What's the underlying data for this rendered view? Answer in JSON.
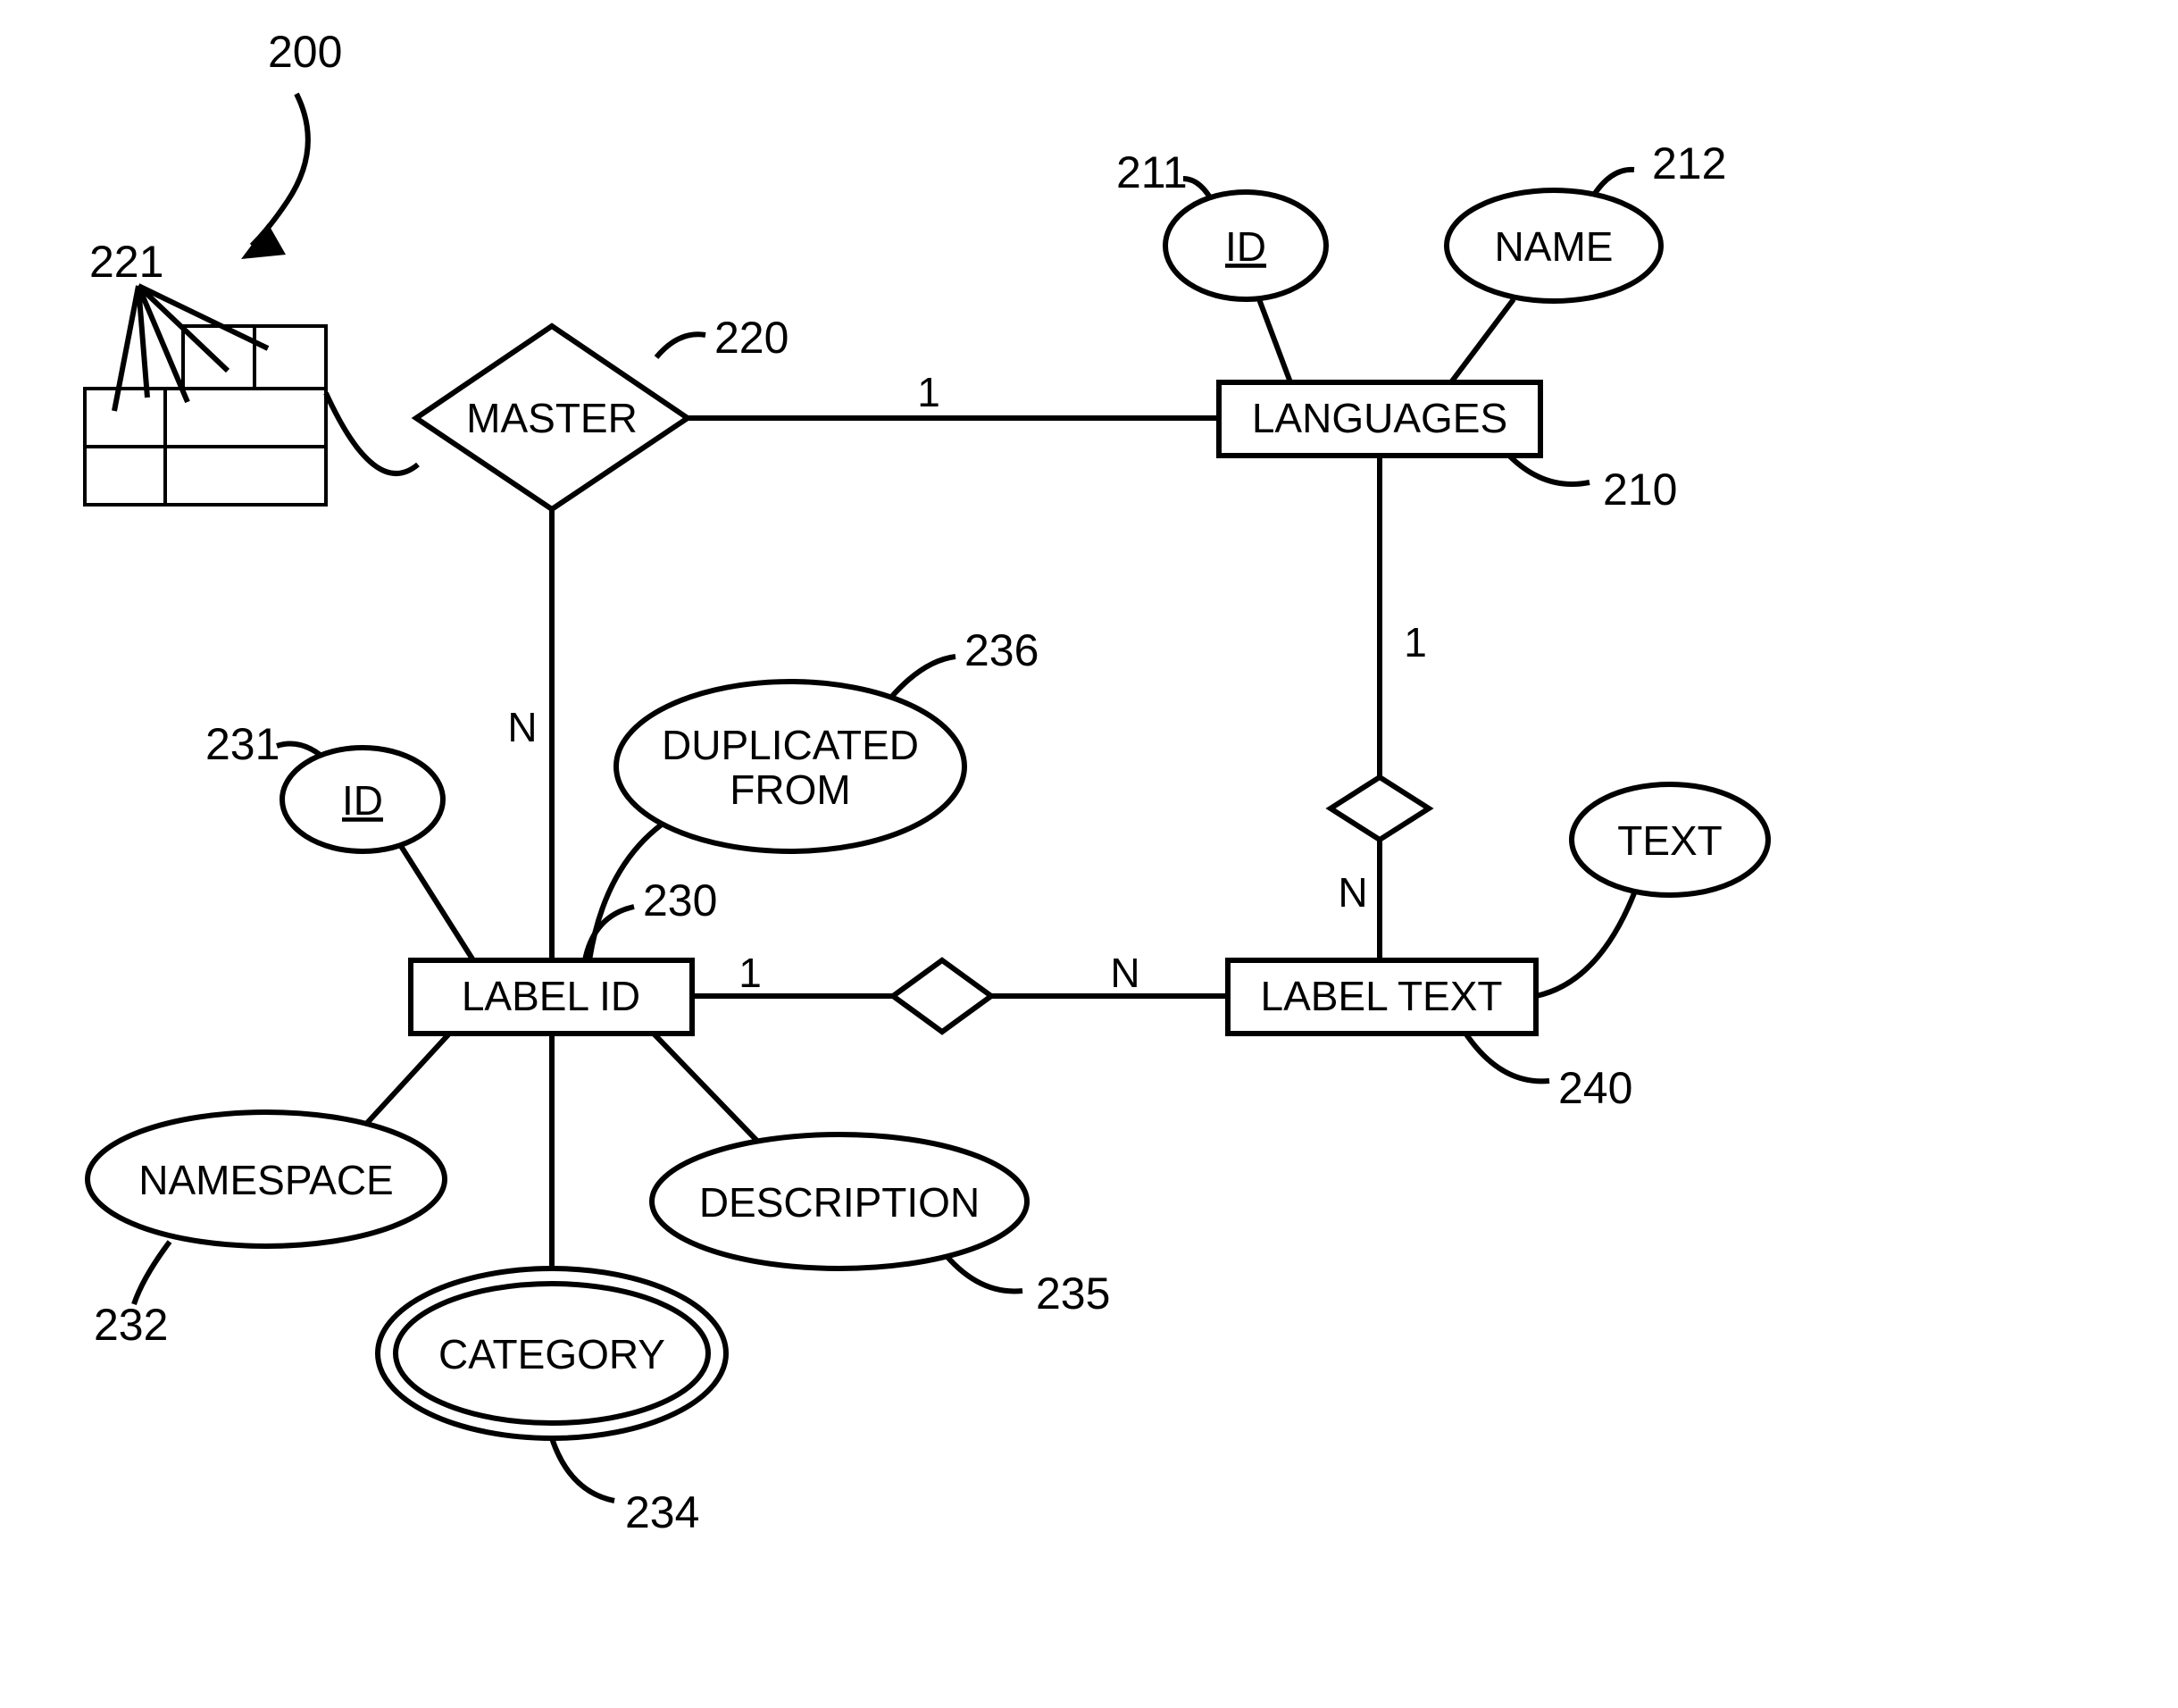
{
  "figure_ref": "200",
  "entities": {
    "languages": {
      "label": "LANGUAGES",
      "ref": "210"
    },
    "label_id": {
      "label": "LABEL ID",
      "ref": "230"
    },
    "label_text": {
      "label": "LABEL TEXT",
      "ref": "240"
    }
  },
  "relationships": {
    "master": {
      "label": "MASTER",
      "ref": "220"
    }
  },
  "attributes": {
    "lang_id": {
      "label": "ID",
      "ref": "211",
      "key": true
    },
    "lang_name": {
      "label": "NAME",
      "ref": "212"
    },
    "lid_id": {
      "label": "ID",
      "ref": "231",
      "key": true
    },
    "namespace": {
      "label": "NAMESPACE",
      "ref": "232"
    },
    "category": {
      "label": "CATEGORY",
      "ref": "234",
      "multi": true
    },
    "description": {
      "label": "DESCRIPTION",
      "ref": "235"
    },
    "dup_from_l1": {
      "label": "DUPLICATED"
    },
    "dup_from_l2": {
      "label": "FROM",
      "ref": "236"
    },
    "text": {
      "label": "TEXT"
    }
  },
  "cardinalities": {
    "master_languages": "1",
    "master_labelid": "N",
    "labelid_labeltext_left": "1",
    "labelid_labeltext_right": "N",
    "languages_labeltext_top": "1",
    "languages_labeltext_bot": "N"
  },
  "table_ref": "221"
}
